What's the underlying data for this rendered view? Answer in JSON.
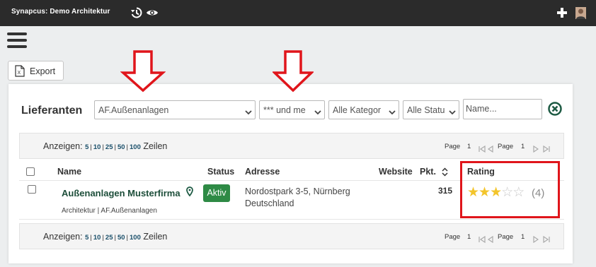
{
  "app": {
    "title": "Synapcus: Demo Architektur"
  },
  "toolbar": {
    "export_label": "Export"
  },
  "page": {
    "title": "Lieferanten"
  },
  "filters": {
    "category_value": "AF.Außenanlagen",
    "rating_value": "*** und me",
    "kategorie_value": "Alle Kategor",
    "status_value": "Alle Statu",
    "name_placeholder": "Name..."
  },
  "pagination": {
    "show_label": "Anzeigen:",
    "options": [
      "5",
      "10",
      "25",
      "50",
      "100"
    ],
    "rows_label": "Zeilen",
    "page_label": "Page",
    "page_number": "1",
    "page_total": "1"
  },
  "table": {
    "headers": {
      "name": "Name",
      "status": "Status",
      "address": "Adresse",
      "website": "Website",
      "points": "Pkt.",
      "rating": "Rating"
    },
    "rows": [
      {
        "name": "Außenanlagen Musterfirma",
        "subtitle": "Architektur | AF.Außenanlagen",
        "status": "Aktiv",
        "address_line1": "Nordostpark 3-5, Nürnberg",
        "address_line2": "Deutschland",
        "points": "315",
        "rating_stars": 3,
        "rating_max": 5,
        "rating_count": "(4)"
      }
    ]
  },
  "colors": {
    "topbar": "#2b2b2b",
    "accent_green": "#2e8a45",
    "link_blue": "#1a4f6a",
    "star": "#f3c52c",
    "annotation_red": "#e0151b"
  }
}
